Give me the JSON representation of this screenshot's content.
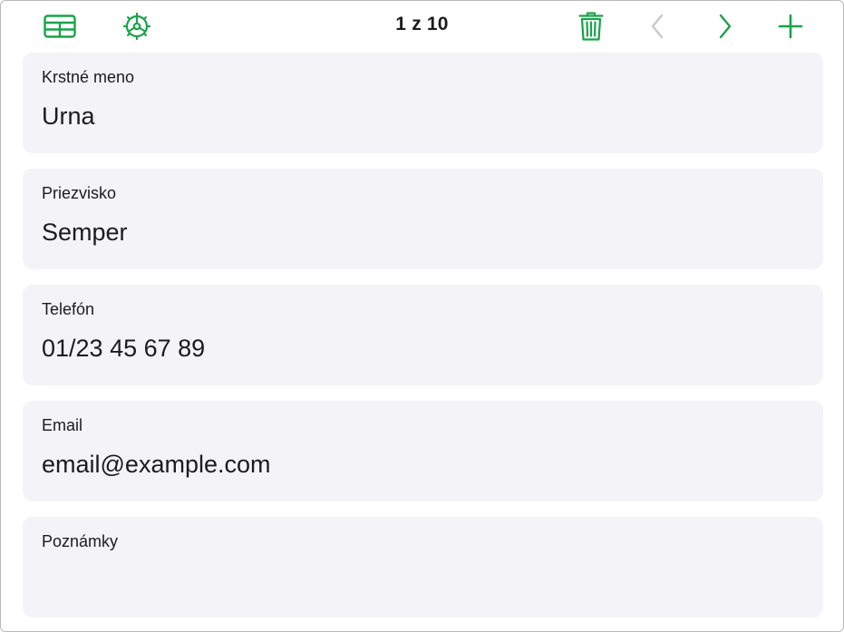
{
  "toolbar": {
    "table_view_icon": "table-icon",
    "settings_icon": "gear-icon",
    "record_counter": "1 z 10",
    "delete_icon": "trash-icon",
    "previous_icon": "chevron-left-icon",
    "next_icon": "chevron-right-icon",
    "add_icon": "plus-icon",
    "accent_color": "#1aa34a",
    "disabled_color": "#c7c7cc"
  },
  "form": {
    "fields": [
      {
        "label": "Krstné meno",
        "value": "Urna"
      },
      {
        "label": "Priezvisko",
        "value": "Semper"
      },
      {
        "label": "Telefón",
        "value": "01/23 45 67 89"
      },
      {
        "label": "Email",
        "value": "email@example.com"
      },
      {
        "label": "Poznámky",
        "value": ""
      }
    ]
  }
}
